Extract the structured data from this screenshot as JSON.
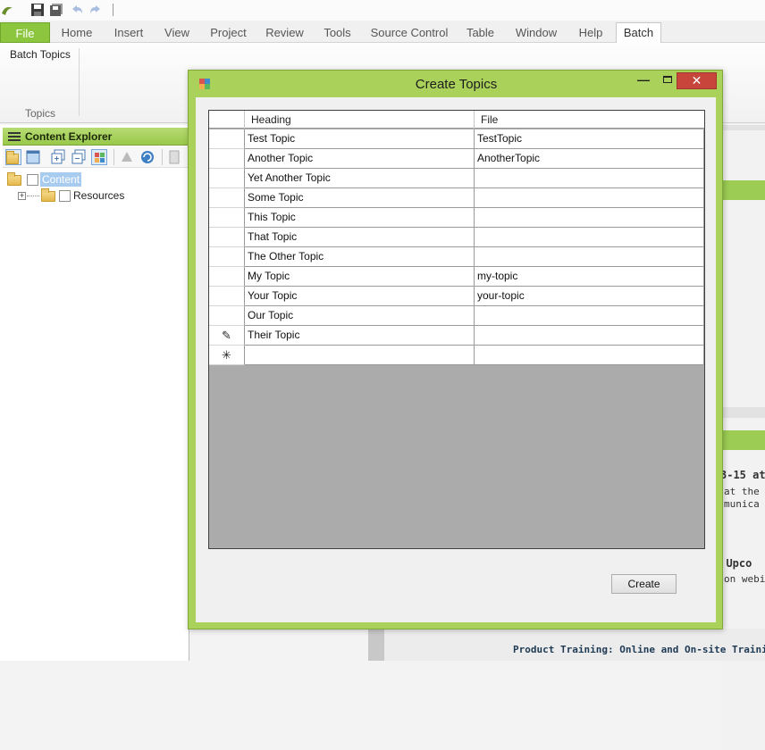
{
  "ribbon_tabs": [
    "File",
    "Home",
    "Insert",
    "View",
    "Project",
    "Review",
    "Tools",
    "Source Control",
    "Table",
    "Window",
    "Help",
    "Batch"
  ],
  "ribbon": {
    "batch_topics_button": "Batch Topics",
    "group_label": "Topics"
  },
  "content_explorer": {
    "title": "Content Explorer",
    "tree": [
      {
        "label": "Content",
        "selected": true
      },
      {
        "label": "Resources",
        "selected": false
      }
    ]
  },
  "background_text": {
    "line1": "3-15 at",
    "line2": "at the H",
    "line3": "munica",
    "line4": "r Upco",
    "line5": "on webi",
    "footer": "Product Training: Online and On-site Trainin"
  },
  "dialog": {
    "title": "Create Topics",
    "close_glyph": "✕",
    "minimize_glyph": "—",
    "columns": [
      "Heading",
      "File"
    ],
    "rows": [
      {
        "marker": "",
        "heading": "Test Topic",
        "file": "TestTopic"
      },
      {
        "marker": "",
        "heading": "Another Topic",
        "file": "AnotherTopic"
      },
      {
        "marker": "",
        "heading": "Yet Another Topic",
        "file": ""
      },
      {
        "marker": "",
        "heading": "Some Topic",
        "file": ""
      },
      {
        "marker": "",
        "heading": "This Topic",
        "file": ""
      },
      {
        "marker": "",
        "heading": "That Topic",
        "file": ""
      },
      {
        "marker": "",
        "heading": "The Other Topic",
        "file": ""
      },
      {
        "marker": "",
        "heading": "My Topic",
        "file": "my-topic"
      },
      {
        "marker": "",
        "heading": "Your Topic",
        "file": "your-topic"
      },
      {
        "marker": "",
        "heading": "Our Topic",
        "file": ""
      },
      {
        "marker": "✎",
        "heading": "Their Topic",
        "file": ""
      },
      {
        "marker": "✳",
        "heading": "",
        "file": ""
      }
    ],
    "create_button": "Create"
  },
  "colors": {
    "accent_green": "#8cc63f",
    "dialog_frame": "#aad15a",
    "close_red": "#c7453a"
  }
}
